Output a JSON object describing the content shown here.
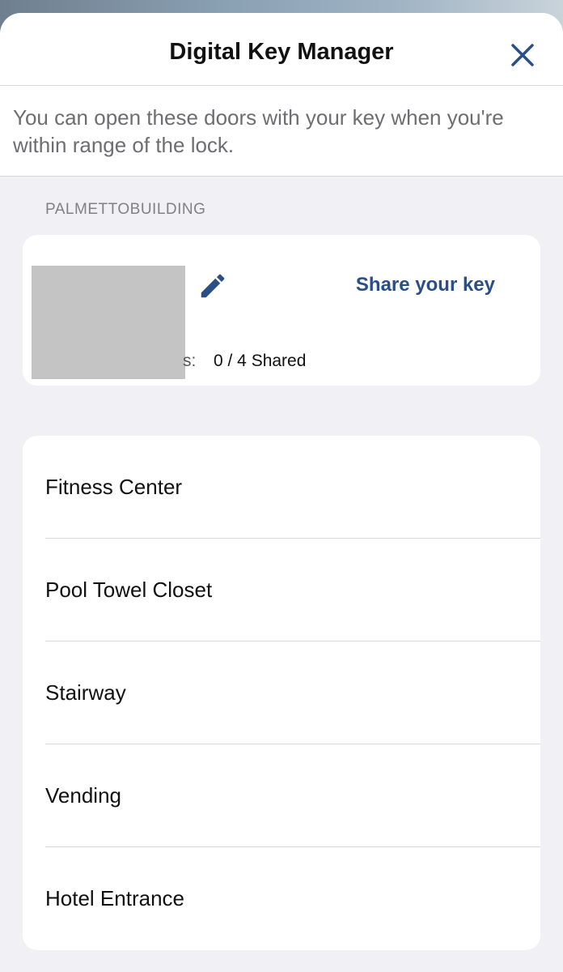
{
  "header": {
    "title": "Digital Key Manager",
    "close_icon": "close-icon"
  },
  "intro": {
    "text": "You can open these doors with your key when you're within range of the lock."
  },
  "building": {
    "label": "PALMETTOBUILDING"
  },
  "key_card": {
    "share_label": "Share your key",
    "shared_prefix": "s:",
    "shared_count": "0 / 4 Shared",
    "edit_icon": "pencil-icon"
  },
  "doors": [
    {
      "label": "Fitness Center"
    },
    {
      "label": "Pool Towel Closet"
    },
    {
      "label": "Stairway"
    },
    {
      "label": "Vending"
    },
    {
      "label": "Hotel Entrance"
    }
  ],
  "colors": {
    "accent": "#2a4f86",
    "background": "#f0f0f5",
    "card": "#ffffff"
  }
}
